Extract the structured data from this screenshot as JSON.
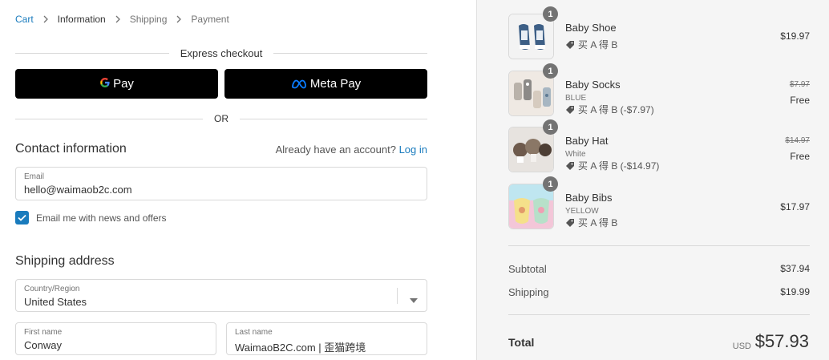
{
  "breadcrumb": {
    "items": [
      {
        "label": "Cart"
      },
      {
        "label": "Information"
      },
      {
        "label": "Shipping"
      },
      {
        "label": "Payment"
      }
    ]
  },
  "express": {
    "title": "Express checkout",
    "gpay_label": "Pay",
    "gpay_g": "G",
    "metapay_label": "Meta Pay",
    "or_label": "OR"
  },
  "contact": {
    "title": "Contact information",
    "account_prompt": "Already have an account?",
    "login_label": "Log in",
    "email_label": "Email",
    "email_value": "hello@waimaob2c.com",
    "newsletter_label": "Email me with news and offers",
    "newsletter_checked": true
  },
  "shipping": {
    "title": "Shipping address",
    "country_label": "Country/Region",
    "country_value": "United States",
    "first_name_label": "First name",
    "first_name_value": "Conway",
    "last_name_label": "Last name",
    "last_name_value": "WaimaoB2C.com | 歪猫跨境"
  },
  "order": {
    "items": [
      {
        "qty": "1",
        "name": "Baby Shoe",
        "variant": "",
        "discount": "买 A 得 B",
        "price": "$19.97",
        "original_price": "",
        "free": ""
      },
      {
        "qty": "1",
        "name": "Baby Socks",
        "variant": "BLUE",
        "discount": "买 A 得 B (-$7.97)",
        "price": "",
        "original_price": "$7.97",
        "free": "Free"
      },
      {
        "qty": "1",
        "name": "Baby Hat",
        "variant": "White",
        "discount": "买 A 得 B (-$14.97)",
        "price": "",
        "original_price": "$14.97",
        "free": "Free"
      },
      {
        "qty": "1",
        "name": "Baby Bibs",
        "variant": "YELLOW",
        "discount": "买 A 得 B",
        "price": "$17.97",
        "original_price": "",
        "free": ""
      }
    ],
    "subtotal_label": "Subtotal",
    "subtotal_value": "$37.94",
    "shipping_label": "Shipping",
    "shipping_value": "$19.99",
    "total_label": "Total",
    "currency": "USD",
    "total_value": "$57.93"
  },
  "colors": {
    "link": "#197bbd",
    "button_bg": "#000000",
    "summary_bg": "#f5f5f5"
  }
}
